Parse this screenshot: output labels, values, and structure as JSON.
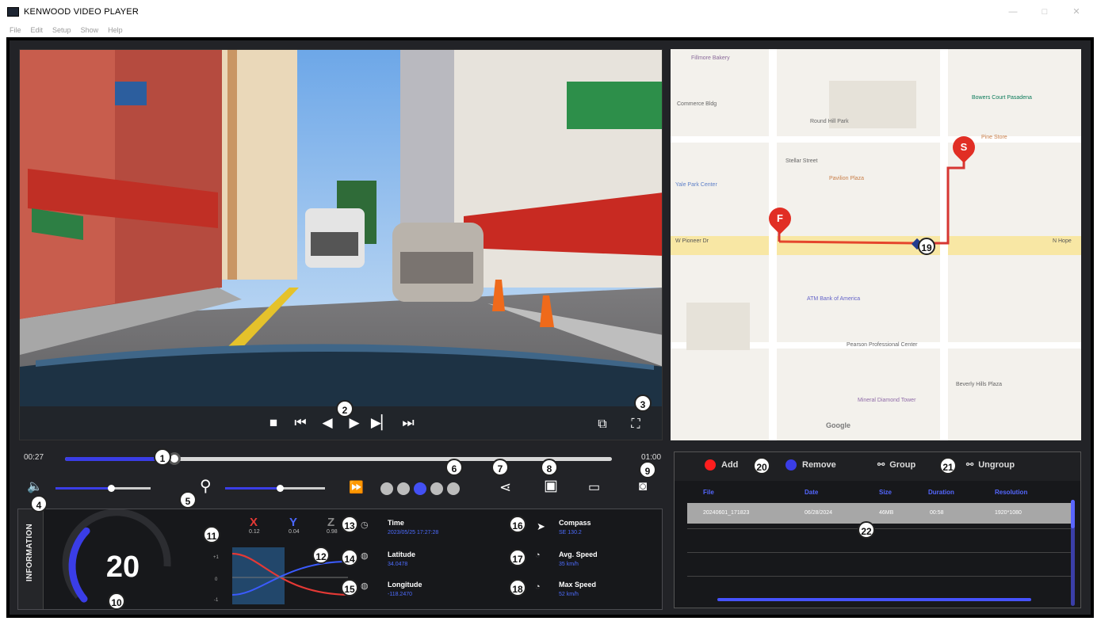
{
  "window": {
    "title": "KENWOOD VIDEO PLAYER",
    "minimize": "—",
    "maximize": "□",
    "close": "✕"
  },
  "menu": [
    "File",
    "Edit",
    "Setup",
    "Show",
    "Help"
  ],
  "video": {
    "controls": [
      "■",
      "⏮",
      "◀",
      "▶",
      "▶▏",
      "⏭"
    ],
    "pip_icon": "⧉",
    "fullscreen_icon": "⛶"
  },
  "map": {
    "streets": [
      "W Pioneer Dr",
      "N Hope"
    ],
    "places": [
      "Fillmore Bakery",
      "Commerce Bldg",
      "Bowers Court Pasadena",
      "Round Hill Park",
      "Stellar Street",
      "Yale Park Center",
      "Pavilion Plaza",
      "Pine Store",
      "ATM Bank of America",
      "Pearson Professional Center",
      "Beverly Hills Plaza",
      "Mineral Diamond Tower",
      "Google"
    ],
    "markers": {
      "start": "S",
      "finish": "F"
    }
  },
  "playback": {
    "current_time": "00:27",
    "total_time": "01:00",
    "progress": 0.2
  },
  "volume": {
    "level": 0.58
  },
  "zoom": {
    "level": 0.55
  },
  "speed_dots": {
    "count": 5,
    "active": 2
  },
  "info": {
    "tab_label": "INFORMATION",
    "speed": "20",
    "speed_fraction": 0.33,
    "gsensor": {
      "x_label": "X",
      "y_label": "Y",
      "z_label": "Z",
      "x_value": "0.12",
      "y_value": "0.04",
      "z_value": "0.98",
      "y_ticks": [
        "+1",
        "0",
        "-1"
      ]
    },
    "time": {
      "label": "Time",
      "value": "2023/05/25 17:27:28"
    },
    "latitude": {
      "label": "Latitude",
      "value": "34.0478"
    },
    "longitude": {
      "label": "Longitude",
      "value": "-118.2470"
    },
    "compass": {
      "label": "Compass",
      "value": "SE 130.2"
    },
    "avg_speed": {
      "label": "Avg. Speed",
      "value": "35 km/h"
    },
    "max_speed": {
      "label": "Max Speed",
      "value": "52 km/h"
    }
  },
  "playlist": {
    "add_label": "Add",
    "remove_label": "Remove",
    "group_label": "Group",
    "ungroup_label": "Ungroup",
    "columns": [
      "File",
      "Date",
      "Size",
      "Duration",
      "Resolution"
    ],
    "rows": [
      [
        "20240601_171823",
        "06/28/2024",
        "46MB",
        "00:58",
        "1920*1080"
      ]
    ]
  },
  "callouts": [
    "1",
    "2",
    "3",
    "4",
    "5",
    "6",
    "7",
    "8",
    "9",
    "10",
    "11",
    "12",
    "13",
    "14",
    "15",
    "16",
    "17",
    "18",
    "19",
    "20",
    "21",
    "22"
  ],
  "colors": {
    "accent": "#3A3DE6",
    "panel": "#17181B",
    "frame": "#222327",
    "start_marker": "#E53935",
    "add": "#FF0000",
    "remove": "#3A3DE6"
  }
}
